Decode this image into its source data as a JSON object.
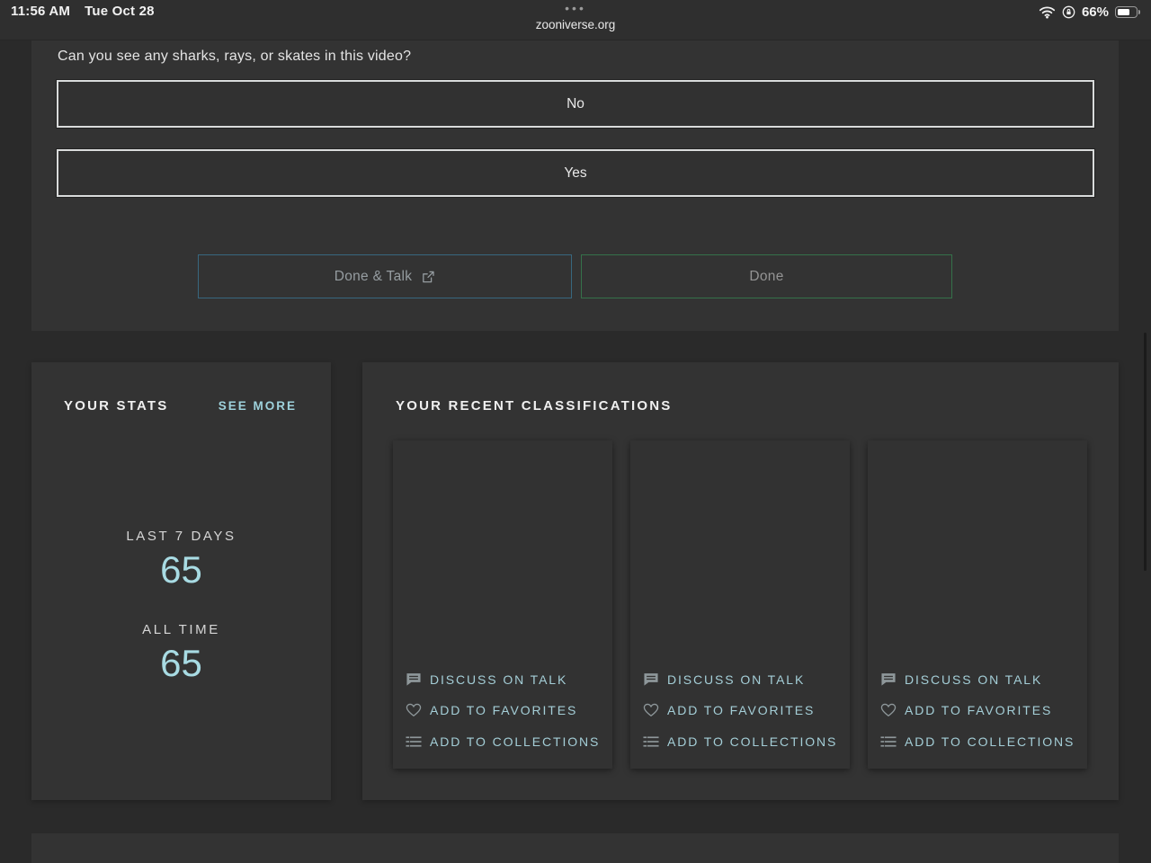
{
  "status_bar": {
    "time": "11:56 AM",
    "date": "Tue Oct 28",
    "tab_overflow_dots": "•••",
    "url": "zooniverse.org",
    "battery_percent": "66%",
    "battery_level_fraction": 0.66
  },
  "task_panel": {
    "question": "Can you see any sharks, rays, or skates in this video?",
    "answer_buttons": [
      {
        "label": "No"
      },
      {
        "label": "Yes"
      }
    ],
    "done_and_talk_button": "Done & Talk",
    "done_button": "Done"
  },
  "stats_panel": {
    "title": "YOUR STATS",
    "see_more_link": "SEE MORE",
    "metrics": [
      {
        "label": "LAST 7 DAYS",
        "value": "65"
      },
      {
        "label": "ALL TIME",
        "value": "65"
      }
    ]
  },
  "classifications_panel": {
    "title": "YOUR RECENT CLASSIFICATIONS",
    "card_count": 3,
    "card_actions": [
      {
        "icon": "speech-bubble-icon",
        "label": "DISCUSS ON TALK"
      },
      {
        "icon": "heart-icon",
        "label": "ADD TO FAVORITES"
      },
      {
        "icon": "list-icon",
        "label": "ADD TO COLLECTIONS"
      }
    ]
  },
  "colors": {
    "page_background": "#2a2a2a",
    "panel_background": "#333333",
    "accent_teal": "#a6d4dd",
    "answer_border": "#d9dbdb",
    "done_talk_border": "#38677f",
    "done_border": "#35714a",
    "muted_text": "#969da1"
  }
}
